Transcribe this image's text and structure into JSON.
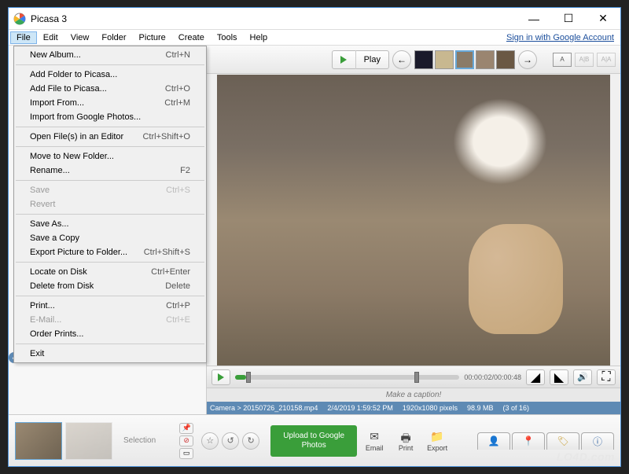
{
  "titlebar": {
    "title": "Picasa 3"
  },
  "menubar": {
    "items": [
      "File",
      "Edit",
      "View",
      "Folder",
      "Picture",
      "Create",
      "Tools",
      "Help"
    ],
    "signin": "Sign in with Google Account"
  },
  "file_menu": {
    "groups": [
      [
        {
          "label": "New Album...",
          "shortcut": "Ctrl+N",
          "disabled": false
        }
      ],
      [
        {
          "label": "Add Folder to Picasa...",
          "shortcut": "",
          "disabled": false
        },
        {
          "label": "Add File to Picasa...",
          "shortcut": "Ctrl+O",
          "disabled": false
        },
        {
          "label": "Import From...",
          "shortcut": "Ctrl+M",
          "disabled": false
        },
        {
          "label": "Import from Google Photos...",
          "shortcut": "",
          "disabled": false
        }
      ],
      [
        {
          "label": "Open File(s) in an Editor",
          "shortcut": "Ctrl+Shift+O",
          "disabled": false
        }
      ],
      [
        {
          "label": "Move to New Folder...",
          "shortcut": "",
          "disabled": false
        },
        {
          "label": "Rename...",
          "shortcut": "F2",
          "disabled": false
        }
      ],
      [
        {
          "label": "Save",
          "shortcut": "Ctrl+S",
          "disabled": true
        },
        {
          "label": "Revert",
          "shortcut": "",
          "disabled": true
        }
      ],
      [
        {
          "label": "Save As...",
          "shortcut": "",
          "disabled": false
        },
        {
          "label": "Save a Copy",
          "shortcut": "",
          "disabled": false
        },
        {
          "label": "Export Picture to Folder...",
          "shortcut": "Ctrl+Shift+S",
          "disabled": false
        }
      ],
      [
        {
          "label": "Locate on Disk",
          "shortcut": "Ctrl+Enter",
          "disabled": false
        },
        {
          "label": "Delete from Disk",
          "shortcut": "Delete",
          "disabled": false
        }
      ],
      [
        {
          "label": "Print...",
          "shortcut": "Ctrl+P",
          "disabled": false
        },
        {
          "label": "E-Mail...",
          "shortcut": "Ctrl+E",
          "disabled": true
        },
        {
          "label": "Order Prints...",
          "shortcut": "",
          "disabled": false
        }
      ],
      [
        {
          "label": "Exit",
          "shortcut": "",
          "disabled": false
        }
      ]
    ]
  },
  "toolbar": {
    "play_label": "Play",
    "layout_labels": [
      "A",
      "A|B",
      "A|A"
    ]
  },
  "playback": {
    "time": "00:00:02/00:00:48"
  },
  "caption": {
    "placeholder": "Make a caption!"
  },
  "infobar": {
    "path": "Camera > 20150726_210158.mp4",
    "datetime": "2/4/2019 1:59:52 PM",
    "dimensions": "1920x1080 pixels",
    "size": "98.9 MB",
    "position": "(3 of 16)"
  },
  "bottom": {
    "selection_label": "Selection",
    "upload_label": "Upload to Google Photos",
    "tools": [
      "Email",
      "Print",
      "Export"
    ]
  },
  "watermark": "LO4D.com"
}
